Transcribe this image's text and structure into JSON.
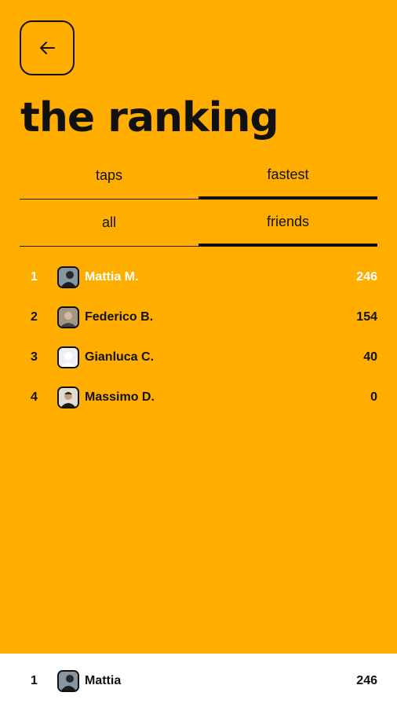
{
  "header": {
    "title": "the ranking"
  },
  "tabs_mode": [
    {
      "label": "taps",
      "active": false
    },
    {
      "label": "fastest",
      "active": true
    }
  ],
  "tabs_scope": [
    {
      "label": "all",
      "active": false
    },
    {
      "label": "friends",
      "active": true
    }
  ],
  "ranking": [
    {
      "pos": "1",
      "name": "Mattia M.",
      "score": "246",
      "is_me": true,
      "avatar": "photo-avatar-icon"
    },
    {
      "pos": "2",
      "name": "Federico B.",
      "score": "154",
      "is_me": false,
      "avatar": "photo-avatar-icon"
    },
    {
      "pos": "3",
      "name": "Gianluca C.",
      "score": "40",
      "is_me": false,
      "avatar": "default-avatar-icon"
    },
    {
      "pos": "4",
      "name": "Massimo D.",
      "score": "0",
      "is_me": false,
      "avatar": "photo-avatar-icon"
    }
  ],
  "footer": {
    "pos": "1",
    "name": "Mattia",
    "score": "246"
  },
  "colors": {
    "background": "#FFAE00",
    "text": "#111111",
    "highlight": "#FFFFFF"
  }
}
